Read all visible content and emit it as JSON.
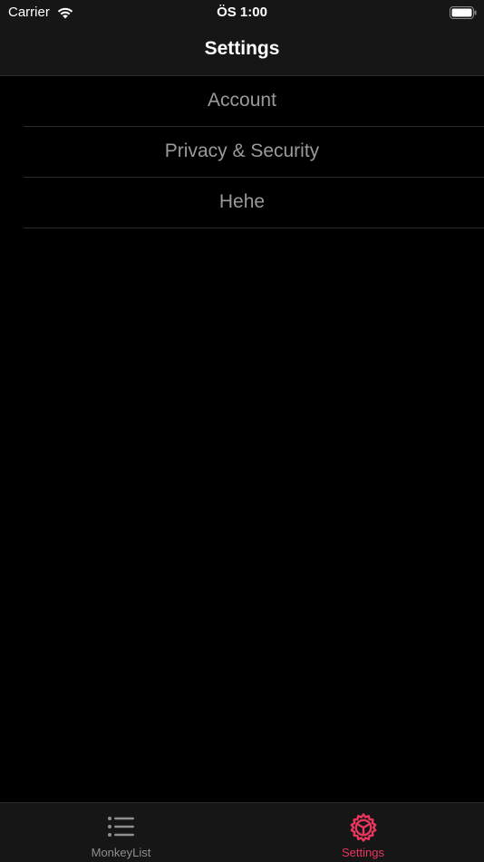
{
  "status_bar": {
    "carrier": "Carrier",
    "time": "ÖS 1:00"
  },
  "nav": {
    "title": "Settings"
  },
  "settings_items": [
    {
      "label": "Account"
    },
    {
      "label": "Privacy & Security"
    },
    {
      "label": "Hehe"
    }
  ],
  "tabs": [
    {
      "label": "MonkeyList",
      "icon": "list-icon",
      "active": false
    },
    {
      "label": "Settings",
      "icon": "gear-icon",
      "active": true
    }
  ],
  "colors": {
    "background": "#000000",
    "bar_background": "#161616",
    "item_text": "#9a9a9a",
    "tab_inactive": "#8e8e93",
    "tab_active": "#e8365d"
  }
}
